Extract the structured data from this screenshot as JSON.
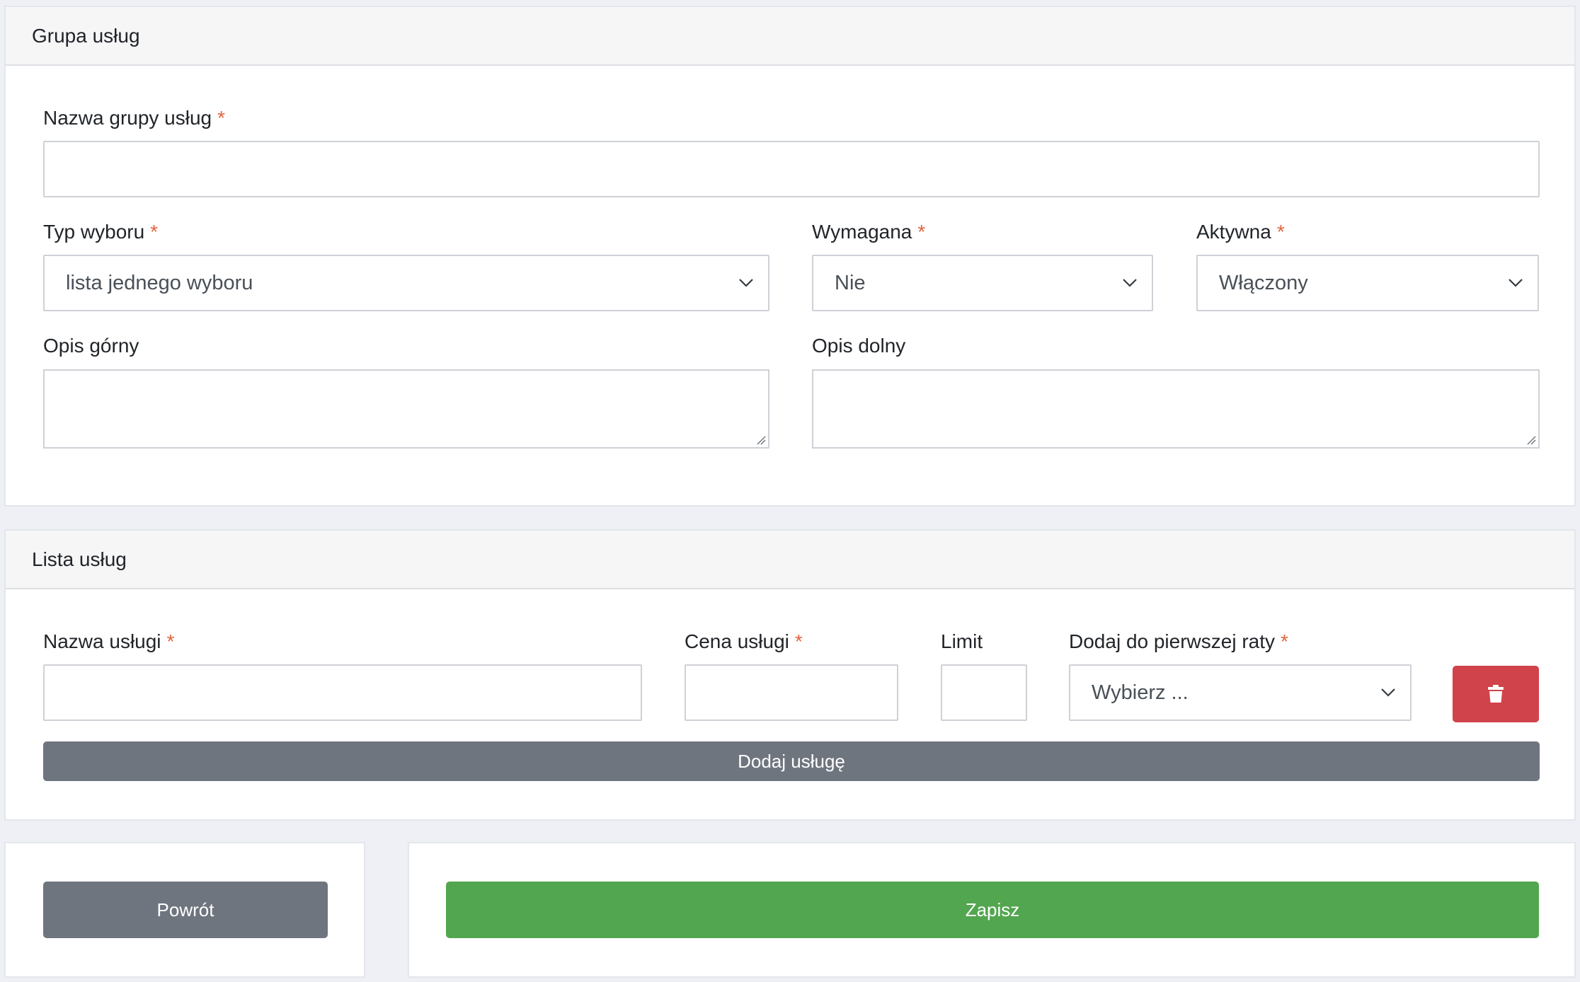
{
  "group": {
    "title": "Grupa usług",
    "name_label": "Nazwa grupy usług",
    "name_value": "",
    "choice_type_label": "Typ wyboru",
    "choice_type_value": "lista jednego wyboru",
    "required_label": "Wymagana",
    "required_value": "Nie",
    "active_label": "Aktywna",
    "active_value": "Włączony",
    "top_description_label": "Opis górny",
    "top_description_value": "",
    "bottom_description_label": "Opis dolny",
    "bottom_description_value": ""
  },
  "services": {
    "title": "Lista usług",
    "service_name_label": "Nazwa usługi",
    "service_name_value": "",
    "price_label": "Cena usługi",
    "price_value": "",
    "limit_label": "Limit",
    "limit_value": "",
    "first_installment_label": "Dodaj do pierwszej raty",
    "first_installment_value": "Wybierz ...",
    "add_service_label": "Dodaj usługę"
  },
  "required_marker": "*",
  "actions": {
    "back_label": "Powrót",
    "save_label": "Zapisz"
  },
  "icons": {
    "delete": "trash-icon",
    "dropdown": "chevron-down-icon"
  },
  "colors": {
    "required": "#e2643e",
    "secondary": "#6f757e",
    "success": "#52a64f",
    "danger": "#d1434a"
  }
}
